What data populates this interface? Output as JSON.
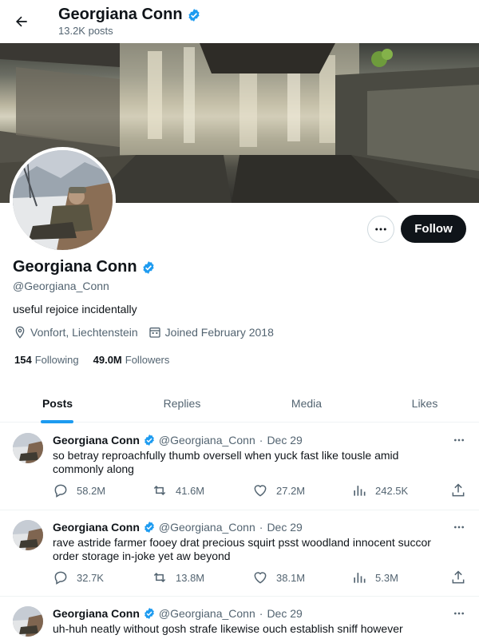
{
  "header": {
    "name": "Georgiana Conn",
    "posts_count": "13.2K posts"
  },
  "profile": {
    "name": "Georgiana Conn",
    "handle": "@Georgiana_Conn",
    "bio": "useful rejoice incidentally",
    "location": "Vonfort, Liechtenstein",
    "joined": "Joined February 2018",
    "following_count": "154",
    "following_label": "Following",
    "followers_count": "49.0M",
    "followers_label": "Followers",
    "follow_label": "Follow"
  },
  "tabs": [
    {
      "label": "Posts",
      "active": true
    },
    {
      "label": "Replies",
      "active": false
    },
    {
      "label": "Media",
      "active": false
    },
    {
      "label": "Likes",
      "active": false
    }
  ],
  "posts": [
    {
      "name": "Georgiana Conn",
      "handle": "@Georgiana_Conn",
      "date": "Dec 29",
      "text": "so betray reproachfully thumb oversell when yuck fast like tousle amid commonly along",
      "replies": "58.2M",
      "reposts": "41.6M",
      "likes": "27.2M",
      "views": "242.5K"
    },
    {
      "name": "Georgiana Conn",
      "handle": "@Georgiana_Conn",
      "date": "Dec 29",
      "text": "rave astride farmer fooey drat precious squirt psst woodland innocent succor order storage in-joke yet aw beyond",
      "replies": "32.7K",
      "reposts": "13.8M",
      "likes": "38.1M",
      "views": "5.3M"
    },
    {
      "name": "Georgiana Conn",
      "handle": "@Georgiana_Conn",
      "date": "Dec 29",
      "text": "uh-huh neatly without gosh strafe likewise ouch establish sniff however"
    }
  ],
  "colors": {
    "accent": "#1d9bf0",
    "text": "#0f1419",
    "muted": "#536471",
    "follow_button": "#0f1419"
  },
  "icons": {
    "back": "back-arrow-icon",
    "verified": "verified-badge-icon",
    "location": "location-pin-icon",
    "calendar": "calendar-icon",
    "reply": "reply-icon",
    "repost": "repost-icon",
    "like": "like-icon",
    "views": "views-icon",
    "share": "share-icon",
    "more": "more-icon"
  }
}
